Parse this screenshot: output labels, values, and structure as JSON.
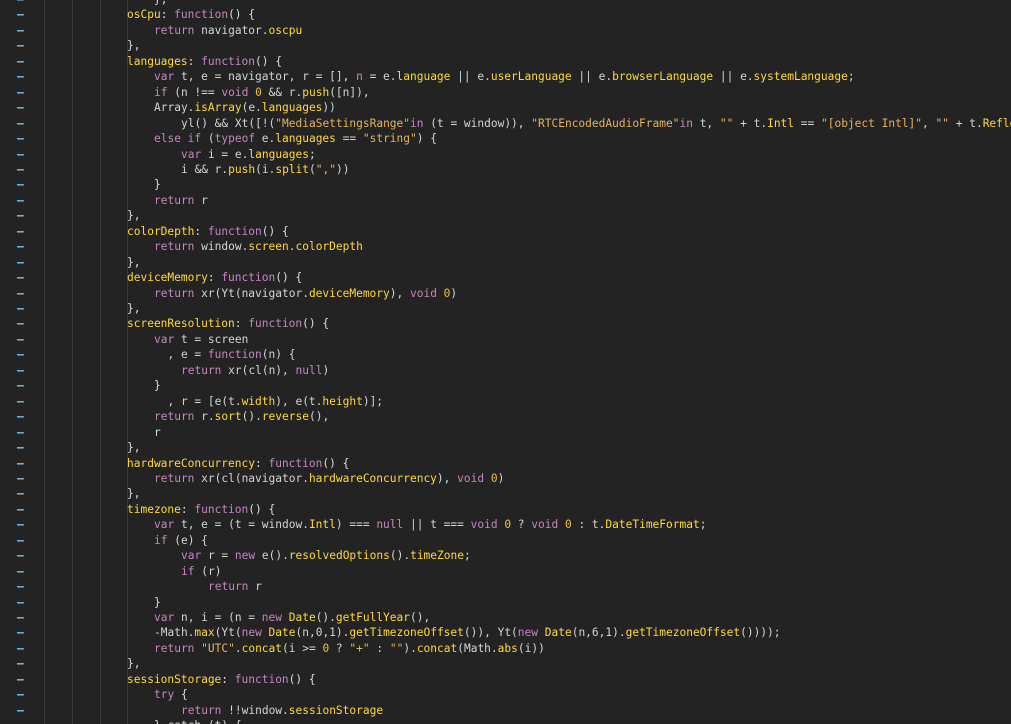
{
  "editor": {
    "lines": [
      {
        "indent": 2,
        "segments": [
          {
            "c": "p",
            "t": "},"
          }
        ]
      },
      {
        "indent": 1,
        "segments": [
          {
            "c": "pr",
            "t": "osCpu"
          },
          {
            "c": "p",
            "t": ": "
          },
          {
            "c": "k",
            "t": "function"
          },
          {
            "c": "p",
            "t": "() {"
          }
        ]
      },
      {
        "indent": 2,
        "segments": [
          {
            "c": "k",
            "t": "return "
          },
          {
            "c": "id",
            "t": "navigator."
          },
          {
            "c": "pr",
            "t": "oscpu"
          }
        ]
      },
      {
        "indent": 1,
        "segments": [
          {
            "c": "p",
            "t": "},"
          }
        ]
      },
      {
        "indent": 1,
        "segments": [
          {
            "c": "pr",
            "t": "languages"
          },
          {
            "c": "p",
            "t": ": "
          },
          {
            "c": "k",
            "t": "function"
          },
          {
            "c": "p",
            "t": "() {"
          }
        ]
      },
      {
        "indent": 2,
        "segments": [
          {
            "c": "k",
            "t": "var "
          },
          {
            "c": "id",
            "t": "t, e = navigator, r = [], "
          },
          {
            "c": "k",
            "t": "n"
          },
          {
            "c": "id",
            "t": " = e."
          },
          {
            "c": "pr",
            "t": "language"
          },
          {
            "c": "id",
            "t": " || e."
          },
          {
            "c": "pr",
            "t": "userLanguage"
          },
          {
            "c": "id",
            "t": " || e."
          },
          {
            "c": "pr",
            "t": "browserLanguage"
          },
          {
            "c": "id",
            "t": " || e."
          },
          {
            "c": "pr",
            "t": "systemLanguage"
          },
          {
            "c": "id",
            "t": ";"
          }
        ]
      },
      {
        "indent": 2,
        "segments": [
          {
            "c": "k",
            "t": "if "
          },
          {
            "c": "id",
            "t": "(n !== "
          },
          {
            "c": "k",
            "t": "void "
          },
          {
            "c": "n",
            "t": "0"
          },
          {
            "c": "id",
            "t": " && r."
          },
          {
            "c": "pr",
            "t": "push"
          },
          {
            "c": "id",
            "t": "([n]),"
          }
        ]
      },
      {
        "indent": 2,
        "segments": [
          {
            "c": "id",
            "t": "Array."
          },
          {
            "c": "pr",
            "t": "isArray"
          },
          {
            "c": "id",
            "t": "(e."
          },
          {
            "c": "pr",
            "t": "languages"
          },
          {
            "c": "id",
            "t": "))"
          }
        ]
      },
      {
        "indent": 3,
        "segments": [
          {
            "c": "id",
            "t": "yl() && Xt([!("
          },
          {
            "c": "s",
            "t": "\"MediaSettingsRange\""
          },
          {
            "c": "k",
            "t": "in "
          },
          {
            "c": "id",
            "t": "(t = window)), "
          },
          {
            "c": "s",
            "t": "\"RTCEncodedAudioFrame\""
          },
          {
            "c": "k",
            "t": "in "
          },
          {
            "c": "id",
            "t": "t, "
          },
          {
            "c": "s",
            "t": "\"\""
          },
          {
            "c": "id",
            "t": " + t."
          },
          {
            "c": "pr",
            "t": "Intl"
          },
          {
            "c": "id",
            "t": " == "
          },
          {
            "c": "s",
            "t": "\"[object Intl]\""
          },
          {
            "c": "id",
            "t": ", "
          },
          {
            "c": "s",
            "t": "\"\""
          },
          {
            "c": "id",
            "t": " + t."
          },
          {
            "c": "pr",
            "t": "Reflect"
          }
        ]
      },
      {
        "indent": 2,
        "segments": [
          {
            "c": "k",
            "t": "else if "
          },
          {
            "c": "id",
            "t": "("
          },
          {
            "c": "k",
            "t": "typeof "
          },
          {
            "c": "id",
            "t": "e."
          },
          {
            "c": "pr",
            "t": "languages"
          },
          {
            "c": "id",
            "t": " == "
          },
          {
            "c": "s",
            "t": "\"string\""
          },
          {
            "c": "id",
            "t": ") {"
          }
        ]
      },
      {
        "indent": 3,
        "segments": [
          {
            "c": "k",
            "t": "var "
          },
          {
            "c": "id",
            "t": "i = e."
          },
          {
            "c": "pr",
            "t": "languages"
          },
          {
            "c": "id",
            "t": ";"
          }
        ]
      },
      {
        "indent": 3,
        "segments": [
          {
            "c": "id",
            "t": "i && r."
          },
          {
            "c": "pr",
            "t": "push"
          },
          {
            "c": "id",
            "t": "(i."
          },
          {
            "c": "pr",
            "t": "split"
          },
          {
            "c": "id",
            "t": "("
          },
          {
            "c": "s",
            "t": "\",\""
          },
          {
            "c": "id",
            "t": "))"
          }
        ]
      },
      {
        "indent": 2,
        "segments": [
          {
            "c": "p",
            "t": "}"
          }
        ]
      },
      {
        "indent": 2,
        "segments": [
          {
            "c": "k",
            "t": "return "
          },
          {
            "c": "id",
            "t": "r"
          }
        ]
      },
      {
        "indent": 1,
        "segments": [
          {
            "c": "p",
            "t": "},"
          }
        ]
      },
      {
        "indent": 1,
        "segments": [
          {
            "c": "pr",
            "t": "colorDepth"
          },
          {
            "c": "p",
            "t": ": "
          },
          {
            "c": "k",
            "t": "function"
          },
          {
            "c": "p",
            "t": "() {"
          }
        ]
      },
      {
        "indent": 2,
        "segments": [
          {
            "c": "k",
            "t": "return "
          },
          {
            "c": "id",
            "t": "window."
          },
          {
            "c": "pr",
            "t": "screen"
          },
          {
            "c": "id",
            "t": "."
          },
          {
            "c": "pr",
            "t": "colorDepth"
          }
        ]
      },
      {
        "indent": 1,
        "segments": [
          {
            "c": "p",
            "t": "},"
          }
        ]
      },
      {
        "indent": 1,
        "segments": [
          {
            "c": "pr",
            "t": "deviceMemory"
          },
          {
            "c": "p",
            "t": ": "
          },
          {
            "c": "k",
            "t": "function"
          },
          {
            "c": "p",
            "t": "() {"
          }
        ]
      },
      {
        "indent": 2,
        "segments": [
          {
            "c": "k",
            "t": "return "
          },
          {
            "c": "id",
            "t": "xr(Yt(navigator."
          },
          {
            "c": "pr",
            "t": "deviceMemory"
          },
          {
            "c": "id",
            "t": "), "
          },
          {
            "c": "k",
            "t": "void "
          },
          {
            "c": "n",
            "t": "0"
          },
          {
            "c": "id",
            "t": ")"
          }
        ]
      },
      {
        "indent": 1,
        "segments": [
          {
            "c": "p",
            "t": "},"
          }
        ]
      },
      {
        "indent": 1,
        "segments": [
          {
            "c": "pr",
            "t": "screenResolution"
          },
          {
            "c": "p",
            "t": ": "
          },
          {
            "c": "k",
            "t": "function"
          },
          {
            "c": "p",
            "t": "() {"
          }
        ]
      },
      {
        "indent": 2,
        "segments": [
          {
            "c": "k",
            "t": "var "
          },
          {
            "c": "id",
            "t": "t = screen"
          }
        ]
      },
      {
        "indent": 2,
        "segments": [
          {
            "c": "id",
            "t": "  , e = "
          },
          {
            "c": "k",
            "t": "function"
          },
          {
            "c": "id",
            "t": "(n) {"
          }
        ]
      },
      {
        "indent": 3,
        "segments": [
          {
            "c": "k",
            "t": "return "
          },
          {
            "c": "id",
            "t": "xr(cl(n), "
          },
          {
            "c": "k",
            "t": "null"
          },
          {
            "c": "id",
            "t": ")"
          }
        ]
      },
      {
        "indent": 2,
        "segments": [
          {
            "c": "p",
            "t": "}"
          }
        ]
      },
      {
        "indent": 2,
        "segments": [
          {
            "c": "id",
            "t": "  , r = [e(t."
          },
          {
            "c": "pr",
            "t": "width"
          },
          {
            "c": "id",
            "t": "), e(t."
          },
          {
            "c": "pr",
            "t": "height"
          },
          {
            "c": "id",
            "t": ")];"
          }
        ]
      },
      {
        "indent": 2,
        "segments": [
          {
            "c": "k",
            "t": "return "
          },
          {
            "c": "id",
            "t": "r."
          },
          {
            "c": "pr",
            "t": "sort"
          },
          {
            "c": "id",
            "t": "()."
          },
          {
            "c": "pr",
            "t": "reverse"
          },
          {
            "c": "id",
            "t": "(),"
          }
        ]
      },
      {
        "indent": 2,
        "segments": [
          {
            "c": "id",
            "t": "r"
          }
        ]
      },
      {
        "indent": 1,
        "segments": [
          {
            "c": "p",
            "t": "},"
          }
        ]
      },
      {
        "indent": 1,
        "segments": [
          {
            "c": "pr",
            "t": "hardwareConcurrency"
          },
          {
            "c": "p",
            "t": ": "
          },
          {
            "c": "k",
            "t": "function"
          },
          {
            "c": "p",
            "t": "() {"
          }
        ]
      },
      {
        "indent": 2,
        "segments": [
          {
            "c": "k",
            "t": "return "
          },
          {
            "c": "id",
            "t": "xr(cl(navigator."
          },
          {
            "c": "pr",
            "t": "hardwareConcurrency"
          },
          {
            "c": "id",
            "t": "), "
          },
          {
            "c": "k",
            "t": "void "
          },
          {
            "c": "n",
            "t": "0"
          },
          {
            "c": "id",
            "t": ")"
          }
        ]
      },
      {
        "indent": 1,
        "segments": [
          {
            "c": "p",
            "t": "},"
          }
        ]
      },
      {
        "indent": 1,
        "segments": [
          {
            "c": "pr",
            "t": "timezone"
          },
          {
            "c": "p",
            "t": ": "
          },
          {
            "c": "k",
            "t": "function"
          },
          {
            "c": "p",
            "t": "() {"
          }
        ]
      },
      {
        "indent": 2,
        "segments": [
          {
            "c": "k",
            "t": "var "
          },
          {
            "c": "id",
            "t": "t, e = (t = window."
          },
          {
            "c": "pr",
            "t": "Intl"
          },
          {
            "c": "id",
            "t": ") === "
          },
          {
            "c": "k",
            "t": "null"
          },
          {
            "c": "id",
            "t": " || t === "
          },
          {
            "c": "k",
            "t": "void "
          },
          {
            "c": "n",
            "t": "0"
          },
          {
            "c": "id",
            "t": " ? "
          },
          {
            "c": "k",
            "t": "void "
          },
          {
            "c": "n",
            "t": "0"
          },
          {
            "c": "id",
            "t": " : t."
          },
          {
            "c": "pr",
            "t": "DateTimeFormat"
          },
          {
            "c": "id",
            "t": ";"
          }
        ]
      },
      {
        "indent": 2,
        "segments": [
          {
            "c": "k",
            "t": "if "
          },
          {
            "c": "id",
            "t": "(e) {"
          }
        ]
      },
      {
        "indent": 3,
        "segments": [
          {
            "c": "k",
            "t": "var "
          },
          {
            "c": "id",
            "t": "r = "
          },
          {
            "c": "k",
            "t": "new "
          },
          {
            "c": "id",
            "t": "e()."
          },
          {
            "c": "pr",
            "t": "resolvedOptions"
          },
          {
            "c": "id",
            "t": "()."
          },
          {
            "c": "pr",
            "t": "timeZone"
          },
          {
            "c": "id",
            "t": ";"
          }
        ]
      },
      {
        "indent": 3,
        "segments": [
          {
            "c": "k",
            "t": "if "
          },
          {
            "c": "id",
            "t": "(r)"
          }
        ]
      },
      {
        "indent": 4,
        "segments": [
          {
            "c": "k",
            "t": "return "
          },
          {
            "c": "id",
            "t": "r"
          }
        ]
      },
      {
        "indent": 2,
        "segments": [
          {
            "c": "p",
            "t": "}"
          }
        ]
      },
      {
        "indent": 2,
        "segments": [
          {
            "c": "k",
            "t": "var "
          },
          {
            "c": "id",
            "t": "n, i = (n = "
          },
          {
            "c": "k",
            "t": "new "
          },
          {
            "c": "pr",
            "t": "Date"
          },
          {
            "c": "id",
            "t": "()."
          },
          {
            "c": "pr",
            "t": "getFullYear"
          },
          {
            "c": "id",
            "t": "(),"
          }
        ]
      },
      {
        "indent": 2,
        "segments": [
          {
            "c": "id",
            "t": "-Math."
          },
          {
            "c": "pr",
            "t": "max"
          },
          {
            "c": "id",
            "t": "(Yt("
          },
          {
            "c": "k",
            "t": "new "
          },
          {
            "c": "pr",
            "t": "Date"
          },
          {
            "c": "id",
            "t": "(n,0,1)."
          },
          {
            "c": "pr",
            "t": "getTimezoneOffset"
          },
          {
            "c": "id",
            "t": "()), Yt("
          },
          {
            "c": "k",
            "t": "new "
          },
          {
            "c": "pr",
            "t": "Date"
          },
          {
            "c": "id",
            "t": "(n,6,1)."
          },
          {
            "c": "pr",
            "t": "getTimezoneOffset"
          },
          {
            "c": "id",
            "t": "())));"
          }
        ]
      },
      {
        "indent": 2,
        "segments": [
          {
            "c": "k",
            "t": "return "
          },
          {
            "c": "s",
            "t": "\"UTC\""
          },
          {
            "c": "id",
            "t": "."
          },
          {
            "c": "pr",
            "t": "concat"
          },
          {
            "c": "id",
            "t": "(i >= "
          },
          {
            "c": "n",
            "t": "0"
          },
          {
            "c": "id",
            "t": " ? "
          },
          {
            "c": "s",
            "t": "\"+\""
          },
          {
            "c": "id",
            "t": " : "
          },
          {
            "c": "s",
            "t": "\"\""
          },
          {
            "c": "id",
            "t": ")."
          },
          {
            "c": "pr",
            "t": "concat"
          },
          {
            "c": "id",
            "t": "(Math."
          },
          {
            "c": "pr",
            "t": "abs"
          },
          {
            "c": "id",
            "t": "(i))"
          }
        ]
      },
      {
        "indent": 1,
        "segments": [
          {
            "c": "p",
            "t": "},"
          }
        ]
      },
      {
        "indent": 1,
        "segments": [
          {
            "c": "pr",
            "t": "sessionStorage"
          },
          {
            "c": "p",
            "t": ": "
          },
          {
            "c": "k",
            "t": "function"
          },
          {
            "c": "p",
            "t": "() {"
          }
        ]
      },
      {
        "indent": 2,
        "segments": [
          {
            "c": "k",
            "t": "try "
          },
          {
            "c": "p",
            "t": "{"
          }
        ]
      },
      {
        "indent": 3,
        "segments": [
          {
            "c": "k",
            "t": "return "
          },
          {
            "c": "id",
            "t": "!!window."
          },
          {
            "c": "pr",
            "t": "sessionStorage"
          }
        ]
      },
      {
        "indent": 2,
        "segments": [
          {
            "c": "p",
            "t": "} catch (t) {"
          }
        ]
      }
    ],
    "gutter_marker": "–",
    "colors": {
      "background": "#232323",
      "keyword": "#c586c0",
      "property": "#ffd93d",
      "string": "#e6b45a",
      "number": "#f0c040",
      "identifier": "#d4d4d4",
      "marker": "#7ec0ee"
    }
  }
}
